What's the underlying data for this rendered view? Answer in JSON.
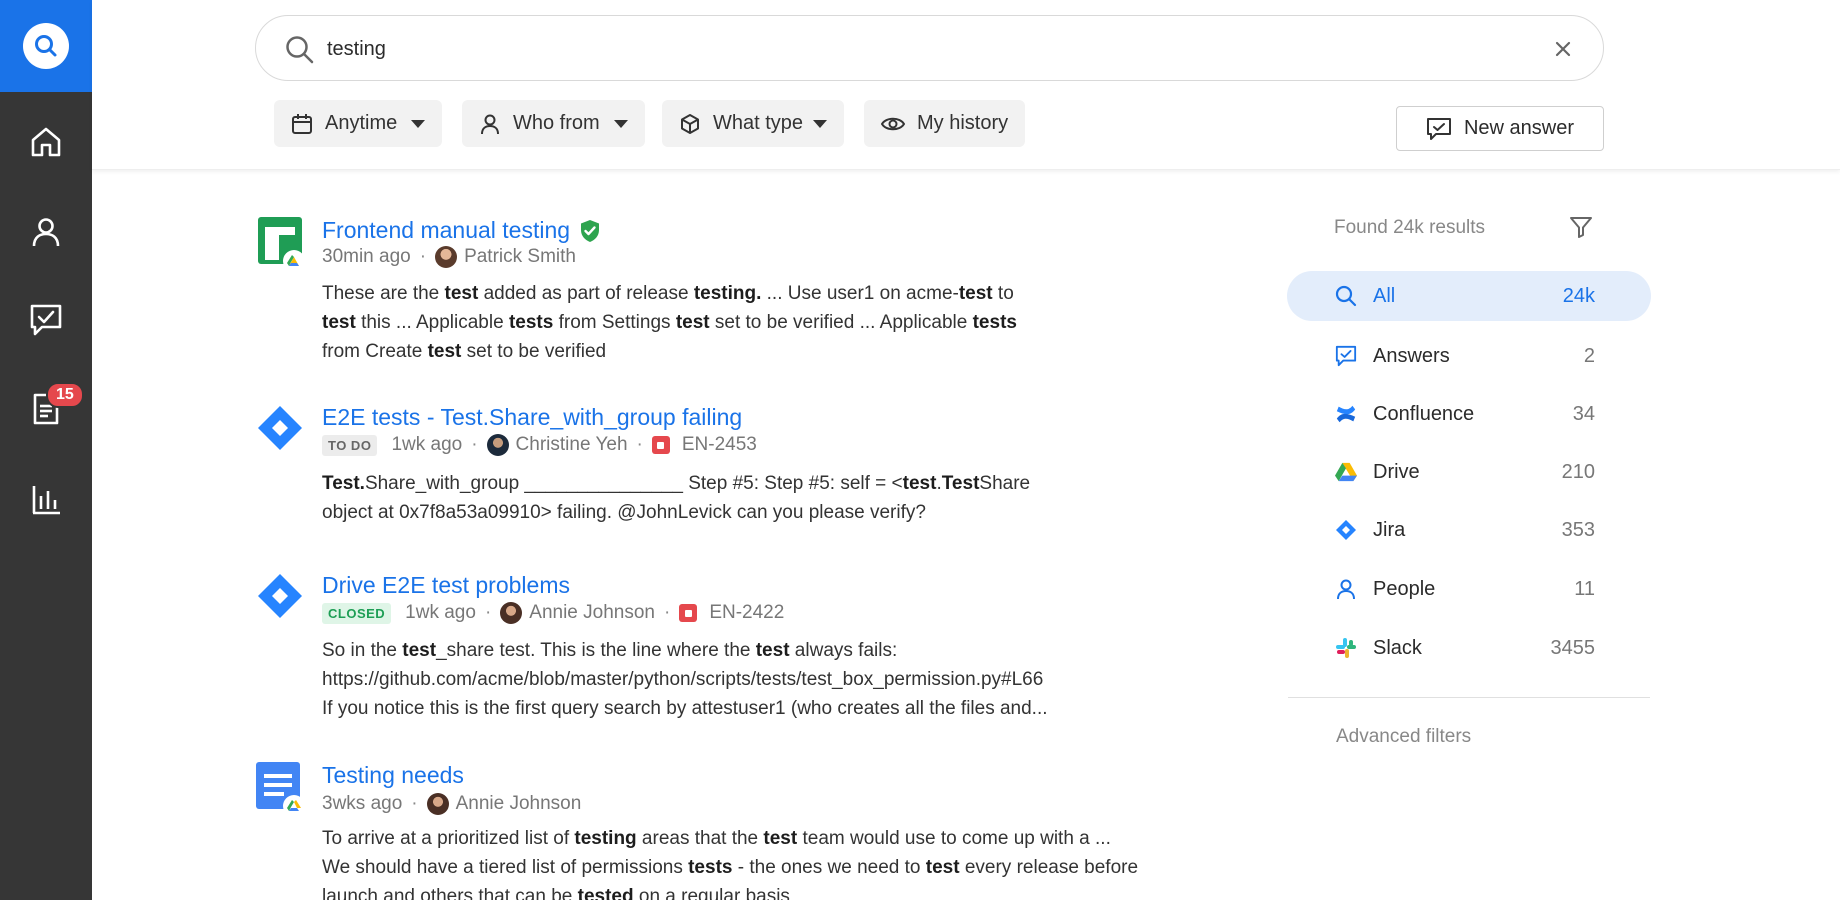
{
  "sidebar": {
    "badge_count": "15",
    "items": [
      "home",
      "people",
      "answers",
      "documents",
      "analytics"
    ]
  },
  "search": {
    "query": "testing",
    "placeholder": "Search"
  },
  "filters": {
    "anytime": "Anytime",
    "who_from": "Who from",
    "what_type": "What type",
    "my_history": "My history"
  },
  "new_answer_label": "New answer",
  "results": [
    {
      "title": "Frontend manual testing",
      "time": "30min ago",
      "author": "Patrick Smith",
      "snippet_lines": [
        "These are the <b>test</b> added as part of release <b>testing.</b> ... Use user1 on acme-<b>test</b> to",
        "<b>test</b> this ... Applicable <b>tests</b> from Settings <b>test</b> set to be verified ... Applicable <b>tests</b>",
        "from Create <b>test</b> set to be verified"
      ]
    },
    {
      "title": "E2E tests - Test.Share_with_group failing",
      "status": "TO DO",
      "time": "1wk ago",
      "author": "Christine Yeh",
      "ticket": "EN-2453",
      "snippet_lines": [
        "<b>Test.</b>Share_with_group _______________ Step #5: Step #5: self = &lt;<b>test</b>.<b>Test</b>Share",
        "object at 0x7f8a53a09910&gt; failing. @JohnLevick can you please verify?"
      ]
    },
    {
      "title": "Drive E2E test problems",
      "status": "CLOSED",
      "time": "1wk ago",
      "author": "Annie Johnson",
      "ticket": "EN-2422",
      "snippet_lines": [
        "So in the <b>test</b>_share test. This is the line where the <b>test</b> always fails:",
        "https://github.com/acme/blob/master/python/scripts/tests/test_box_permission.py#L66",
        "If you notice this is the first query search by attestuser1 (who creates all the files and..."
      ]
    },
    {
      "title": "Testing needs",
      "time": "3wks ago",
      "author": "Annie Johnson",
      "snippet_lines": [
        "To arrive at a prioritized list of <b>testing</b> areas that the <b>test</b> team would use to come up with a ...",
        "We should have a tiered list of permissions <b>tests</b> - the ones we need to <b>test</b> every release before",
        "launch and others that can be <b>tested</b> on a regular basis"
      ]
    }
  ],
  "panel": {
    "found": "Found 24k results",
    "facets": [
      {
        "label": "All",
        "count": "24k",
        "icon": "search-icon"
      },
      {
        "label": "Answers",
        "count": "2",
        "icon": "answers-icon"
      },
      {
        "label": "Confluence",
        "count": "34",
        "icon": "confluence-icon"
      },
      {
        "label": "Drive",
        "count": "210",
        "icon": "drive-icon"
      },
      {
        "label": "Jira",
        "count": "353",
        "icon": "jira-icon"
      },
      {
        "label": "People",
        "count": "11",
        "icon": "people-icon"
      },
      {
        "label": "Slack",
        "count": "3455",
        "icon": "slack-icon"
      }
    ],
    "advanced": "Advanced filters"
  },
  "colors": {
    "accent": "#1a73e8",
    "sidebar": "#363636",
    "badge": "#e5484d",
    "verified": "#2ea44f"
  }
}
